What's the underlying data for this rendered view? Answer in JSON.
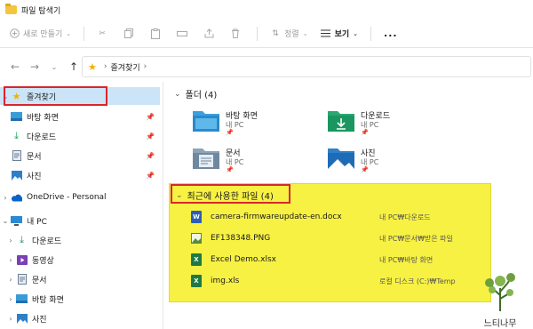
{
  "window": {
    "title": "파일 탐색기"
  },
  "toolbar": {
    "new_label": "새로 만들기",
    "sort_label": "정렬",
    "view_label": "보기",
    "more_label": "..."
  },
  "address": {
    "crumb": "즐겨찾기"
  },
  "sidebar": {
    "favorites": "즐겨찾기",
    "fav_items": [
      "바탕 화면",
      "다운로드",
      "문서",
      "사진"
    ],
    "onedrive": "OneDrive - Personal",
    "thispc": "내 PC",
    "pc_items": [
      "다운로드",
      "동영상",
      "문서",
      "바탕 화면",
      "사진"
    ]
  },
  "folders": {
    "title": "폴더 (4)",
    "items": [
      {
        "name": "바탕 화면",
        "sub": "내 PC"
      },
      {
        "name": "다운로드",
        "sub": "내 PC"
      },
      {
        "name": "문서",
        "sub": "내 PC"
      },
      {
        "name": "사진",
        "sub": "내 PC"
      }
    ]
  },
  "recent": {
    "title": "최근에 사용한 파일 (4)",
    "files": [
      {
        "name": "camera-firmwareupdate-en.docx",
        "loc": "내 PC₩다운로드",
        "type": "word-icon"
      },
      {
        "name": "EF138348.PNG",
        "loc": "내 PC₩문서₩받은 파일",
        "type": "image-icon"
      },
      {
        "name": "Excel Demo.xlsx",
        "loc": "내 PC₩바탕 화면",
        "type": "excel-icon"
      },
      {
        "name": "img.xls",
        "loc": "로컬 디스크 (C:)₩Temp",
        "type": "excel-icon"
      }
    ]
  },
  "watermark": {
    "text": "느티나무"
  },
  "colors": {
    "highlight": "#f7f143",
    "annotation": "#d9262c",
    "selection": "#cce4f7"
  }
}
